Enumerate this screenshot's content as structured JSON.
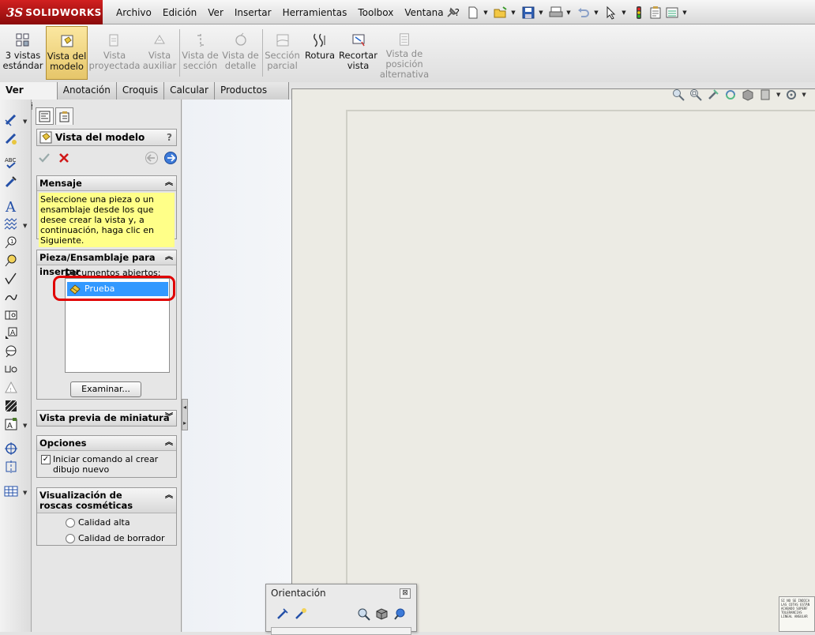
{
  "app": {
    "logo_ds": "3S",
    "logo_text": "SOLIDWORKS"
  },
  "menu": [
    "Archivo",
    "Edición",
    "Ver",
    "Insertar",
    "Herramientas",
    "Toolbox",
    "Ventana",
    "?"
  ],
  "command_manager": {
    "items": [
      {
        "line1": "3 vistas",
        "line2": "estándar",
        "line3": ""
      },
      {
        "line1": "Vista del",
        "line2": "modelo",
        "line3": ""
      },
      {
        "line1": "Vista",
        "line2": "proyectada",
        "line3": ""
      },
      {
        "line1": "Vista",
        "line2": "auxiliar",
        "line3": ""
      },
      {
        "line1": "Vista de",
        "line2": "sección",
        "line3": ""
      },
      {
        "line1": "Vista de",
        "line2": "detalle",
        "line3": ""
      },
      {
        "line1": "Sección",
        "line2": "parcial",
        "line3": ""
      },
      {
        "line1": "Rotura",
        "line2": "",
        "line3": ""
      },
      {
        "line1": "Recortar",
        "line2": "vista",
        "line3": ""
      },
      {
        "line1": "Vista de",
        "line2": "posición",
        "line3": "alternativa"
      }
    ]
  },
  "tabs": [
    "Ver diseño",
    "Anotación",
    "Croquis",
    "Calcular",
    "Productos Office"
  ],
  "property_manager": {
    "title": "Vista del modelo",
    "help": "?",
    "message": {
      "header": "Mensaje",
      "text": "Seleccione una pieza o un ensamblaje desde los que desee crear la vista y, a continuación, haga clic en Siguiente."
    },
    "part_assembly": {
      "header": "Pieza/Ensamblaje para insertar",
      "open_docs_label": "Documentos abiertos:",
      "selected_doc": "Prueba Multicuerpo",
      "browse_button": "Examinar..."
    },
    "thumbnail": {
      "header": "Vista previa de miniatura"
    },
    "options": {
      "header": "Opciones",
      "checkbox_label": "Iniciar comando al crear dibujo nuevo",
      "checked": true
    },
    "thread_display": {
      "header": "Visualización de roscas cosméticas",
      "option_high": "Calidad alta",
      "option_draft": "Calidad de borrador"
    }
  },
  "orientation": {
    "title": "Orientación",
    "close": "⊠"
  },
  "titleblock": "SI NO SE INDICA LAS COTAS ESTÁN ACABADO SUPERF TOLERANCIAS LINEAL ANGULAR"
}
